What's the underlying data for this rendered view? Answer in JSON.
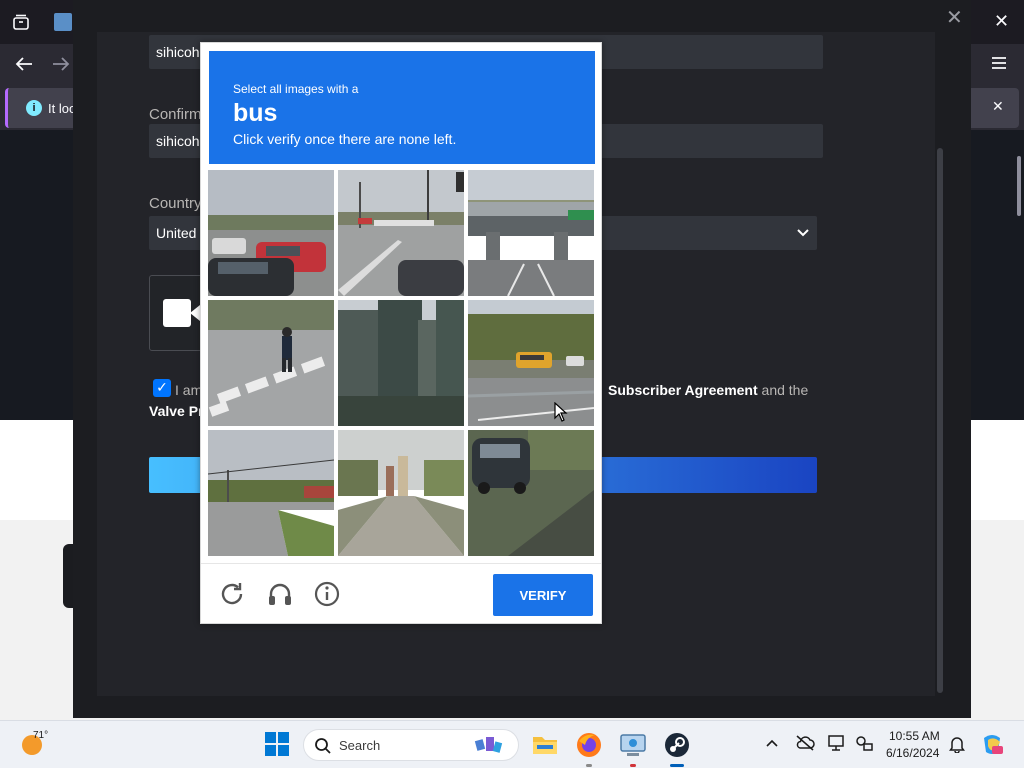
{
  "browser": {
    "notification_text": "It loo",
    "icons": [
      "tab-list-icon",
      "back-icon",
      "forward-icon",
      "window-close-icon",
      "menu-icon",
      "info-icon"
    ]
  },
  "steam": {
    "username_value": "sihicoh",
    "confirm_label": "Confirm",
    "confirm_value": "sihicoh",
    "country_label": "Country",
    "country_value": "United",
    "agree_prefix": "I am",
    "agree_link": "Subscriber Agreement",
    "agree_suffix": "and the",
    "agree_line2": "Valve Pr"
  },
  "challenge": {
    "prompt": "Select all images with a",
    "target": "bus",
    "instruction": "Click verify once there are none left.",
    "verify_label": "VERIFY",
    "tiles": [
      {
        "scene": "parked cars in lot"
      },
      {
        "scene": "parking lot with street lights"
      },
      {
        "scene": "highway overpass"
      },
      {
        "scene": "pedestrian on crosswalk"
      },
      {
        "scene": "tall buildings"
      },
      {
        "scene": "road with school bus"
      },
      {
        "scene": "suburban intersection"
      },
      {
        "scene": "city road with buildings"
      },
      {
        "scene": "parked dark SUV"
      }
    ]
  },
  "taskbar": {
    "temperature": "71°",
    "search_placeholder": "Search",
    "time": "10:55 AM",
    "date": "6/16/2024",
    "apps": [
      "start-icon",
      "file-explorer-icon",
      "firefox-icon",
      "remote-desktop-icon",
      "steam-icon"
    ]
  },
  "colors": {
    "hcaptcha_blue": "#1a73e8",
    "steam_bg": "#1c1d21",
    "field_bg": "#32353c"
  }
}
